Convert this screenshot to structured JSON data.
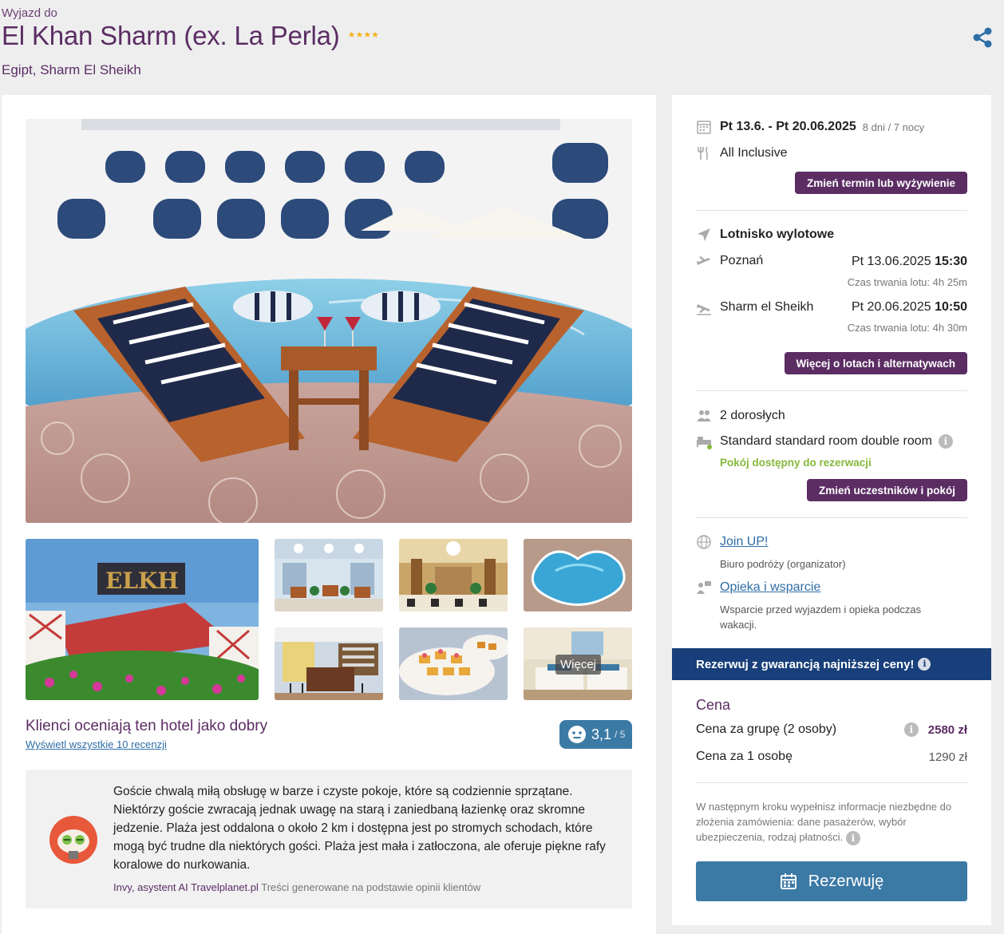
{
  "header": {
    "eyebrow": "Wyjazd do",
    "title": "El Khan Sharm (ex. La Perla)",
    "stars": "★★★★",
    "location": "Egipt, Sharm El Sheikh"
  },
  "gallery": {
    "more_label": "Więcej"
  },
  "rating": {
    "title": "Klienci oceniają ten hotel jako dobry",
    "link": "Wyświetl wszystkie 10 recenzji",
    "score": "3,1",
    "max": "/ 5"
  },
  "summary": {
    "text": "Goście chwalą miłą obsługę w barze i czyste pokoje, które są codziennie sprzątane. Niektórzy goście zwracają jednak uwagę na starą i zaniedbaną łazienkę oraz skromne jedzenie. Plaża jest oddalona o około 2 km i dostępna jest po stromych schodach, które mogą być trudne dla niektórych gości. Plaża jest mała i zatłoczona, ale oferuje piękne rafy koralowe do nurkowania.",
    "author": "Invy, asystent AI Travelplanet.pl",
    "note": "Treści generowane na podstawie opinii klientów"
  },
  "booking": {
    "dates": "Pt 13.6. - Pt 20.06.2025",
    "duration": "8 dni / 7 nocy",
    "board": "All Inclusive",
    "change_date_btn": "Zmień termin lub wyżywienie",
    "airport_title": "Lotnisko wylotowe",
    "outbound_city": "Poznań",
    "outbound_date": "Pt 13.06.2025",
    "outbound_time": "15:30",
    "outbound_duration": "Czas trwania lotu: 4h 25m",
    "return_city": "Sharm el Sheikh",
    "return_date": "Pt 20.06.2025",
    "return_time": "10:50",
    "return_duration": "Czas trwania lotu: 4h 30m",
    "flights_btn": "Więcej o lotach i alternatywach",
    "travellers": "2 dorosłych",
    "room": "Standard standard room double room",
    "availability": "Pokój dostępny do rezerwacji",
    "change_room_btn": "Zmień uczestników i pokój",
    "organizer_name": "Join UP!",
    "organizer_desc": "Biuro podróży (organizator)",
    "support_link": "Opieka i wsparcie",
    "support_desc": "Wsparcie przed wyjazdem i opieka podczas wakacji.",
    "guarantee": "Rezerwuj z gwarancją najniższej ceny!",
    "price_title": "Cena",
    "group_price_label": "Cena za grupę (2 osoby)",
    "group_price": "2580 zł",
    "person_price_label": "Cena za 1 osobę",
    "person_price": "1290 zł",
    "next_step_note": "W następnym kroku wypełnisz informacje niezbędne do złożenia zamówienia: dane pasażerów, wybór ubezpieczenia, rodzaj płatności.",
    "book_btn": "Rezerwuję"
  },
  "colors": {
    "brand_purple": "#5b2d63",
    "accent_blue": "#3c7aa6",
    "guarantee_navy": "#183f7a",
    "available_green": "#86b93c",
    "star_gold": "#f2b31b"
  }
}
